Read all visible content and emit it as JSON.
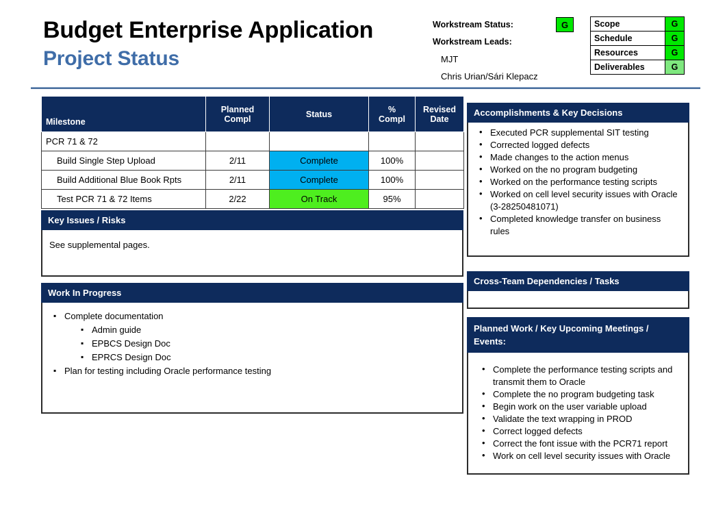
{
  "header": {
    "title_main": "Budget Enterprise Application",
    "title_sub": "Project Status",
    "workstream_status_label": "Workstream Status:",
    "workstream_status_value": "G",
    "workstream_leads_label": "Workstream Leads:",
    "leads": [
      "MJT",
      "Chris Urian/Sári Klepacz"
    ],
    "status_items": [
      {
        "label": "Scope",
        "value": "G",
        "color": "#00E800"
      },
      {
        "label": "Schedule",
        "value": "G",
        "color": "#00E800"
      },
      {
        "label": "Resources",
        "value": "G",
        "color": "#00E800"
      },
      {
        "label": "Deliverables",
        "value": "G",
        "color": "#7FE87F"
      }
    ]
  },
  "milestone_table": {
    "columns": [
      "Milestone",
      "Planned Compl",
      "Status",
      "% Compl",
      "Revised Date"
    ],
    "columns_split": [
      {
        "l1": "Milestone",
        "l2": ""
      },
      {
        "l1": "Planned",
        "l2": "Compl"
      },
      {
        "l1": "Status",
        "l2": ""
      },
      {
        "l1": "%",
        "l2": "Compl"
      },
      {
        "l1": "Revised",
        "l2": "Date"
      }
    ],
    "rows": [
      {
        "milestone": "PCR 71 & 72",
        "indent": false,
        "planned": "",
        "status": "",
        "status_kind": "none",
        "pct": "",
        "revised": ""
      },
      {
        "milestone": "Build Single Step Upload",
        "indent": true,
        "planned": "2/11",
        "status": "Complete",
        "status_kind": "complete",
        "pct": "100%",
        "revised": ""
      },
      {
        "milestone": "Build Additional Blue Book Rpts",
        "indent": true,
        "planned": "2/11",
        "status": "Complete",
        "status_kind": "complete",
        "pct": "100%",
        "revised": ""
      },
      {
        "milestone": "Test PCR 71 & 72 Items",
        "indent": true,
        "planned": "2/22",
        "status": "On Track",
        "status_kind": "ontrack",
        "pct": "95%",
        "revised": ""
      }
    ]
  },
  "key_issues": {
    "header": "Key Issues / Risks",
    "text": "See supplemental pages."
  },
  "work_in_progress": {
    "header": "Work In Progress",
    "items": [
      {
        "text": "Complete documentation",
        "level": 1
      },
      {
        "text": "Admin guide",
        "level": 2
      },
      {
        "text": "EPBCS Design Doc",
        "level": 2
      },
      {
        "text": "EPRCS Design Doc",
        "level": 2
      },
      {
        "text": "Plan for testing including Oracle performance testing",
        "level": 1
      }
    ]
  },
  "accomplishments": {
    "header": "Accomplishments  & Key Decisions",
    "items": [
      "Executed PCR supplemental SIT testing",
      "Corrected logged defects",
      "Made changes to the action menus",
      "Worked on the no program budgeting",
      "Worked on the performance testing scripts",
      "Worked on cell level security issues with Oracle (3-28250481071)",
      "Completed knowledge transfer on business rules"
    ]
  },
  "cross_team": {
    "header": "Cross-Team Dependencies /  Tasks",
    "items": []
  },
  "planned_work": {
    "header": "Planned Work / Key  Upcoming Meetings / Events:",
    "items": [
      "Complete the performance testing scripts and transmit them to Oracle",
      "Complete the no program budgeting task",
      "Begin work on the user variable upload",
      "Validate the text wrapping in PROD",
      "Correct logged defects",
      "Correct the font issue with the PCR71 report",
      "Work on cell level security issues with Oracle"
    ]
  },
  "colors": {
    "navy": "#0E2B5C",
    "title_blue": "#3F6DA8",
    "complete_cyan": "#00B0F0",
    "ontrack_green": "#4EEE1F",
    "status_green": "#00E800",
    "status_green_light": "#7FE87F",
    "rule_blue": "#4A6F9E"
  }
}
